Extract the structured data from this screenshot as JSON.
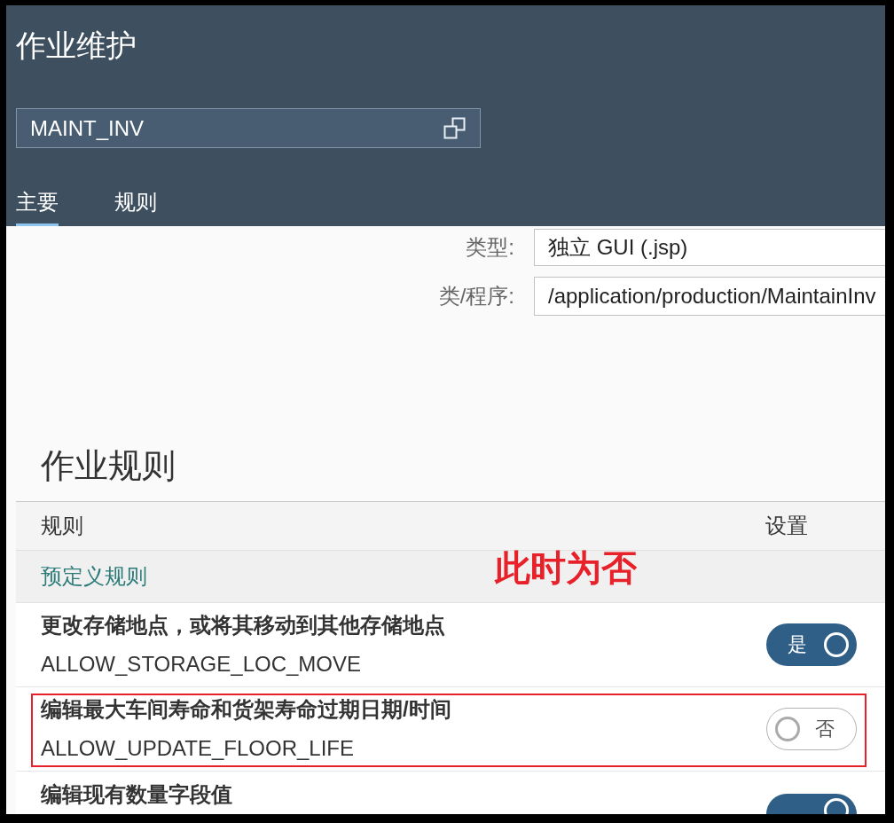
{
  "page": {
    "title": "作业维护"
  },
  "activity_field": {
    "value": "MAINT_INV"
  },
  "tabs": [
    {
      "label": "主要",
      "selected": true
    },
    {
      "label": "规则",
      "selected": false
    }
  ],
  "form": [
    {
      "label": "类型:",
      "value": "独立 GUI (.jsp)"
    },
    {
      "label": "类/程序:",
      "value": "/application/production/MaintainInv"
    }
  ],
  "rules_section": {
    "title": "作业规则",
    "columns": [
      "规则",
      "设置"
    ],
    "group": "预定义规则",
    "rows": [
      {
        "title": "更改存储地点，或将其移动到其他存储地点",
        "code": "ALLOW_STORAGE_LOC_MOVE",
        "on": true,
        "toggle_label": "是",
        "highlighted": false
      },
      {
        "title": "编辑最大车间寿命和货架寿命过期日期/时间",
        "code": "ALLOW_UPDATE_FLOOR_LIFE",
        "on": false,
        "toggle_label": "否",
        "highlighted": true
      },
      {
        "title": "编辑现有数量字段值",
        "on": true,
        "highlighted": false
      }
    ]
  },
  "annotation": {
    "text": "此时为否"
  }
}
